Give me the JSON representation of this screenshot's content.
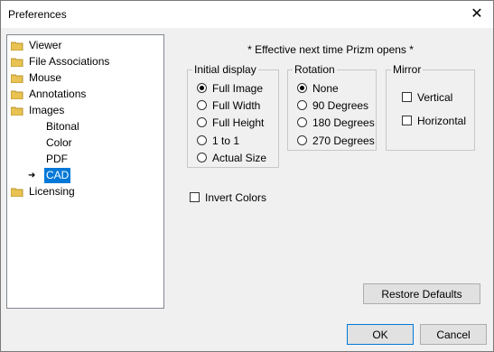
{
  "window": {
    "title": "Preferences",
    "close_glyph": "✕"
  },
  "tree": {
    "items": [
      {
        "label": "Viewer",
        "icon": "folder-icon"
      },
      {
        "label": "File Associations",
        "icon": "folder-icon"
      },
      {
        "label": "Mouse",
        "icon": "folder-icon"
      },
      {
        "label": "Annotations",
        "icon": "folder-icon"
      },
      {
        "label": "Images",
        "icon": "folder-icon"
      },
      {
        "label": "Bitonal"
      },
      {
        "label": "Color"
      },
      {
        "label": "PDF"
      },
      {
        "label": "CAD",
        "selected": true
      },
      {
        "label": "Licensing",
        "icon": "folder-icon"
      }
    ]
  },
  "note": "* Effective next time Prizm opens *",
  "initial_display": {
    "title": "Initial display",
    "options": [
      "Full Image",
      "Full Width",
      "Full Height",
      "1 to 1",
      "Actual Size"
    ],
    "selected": "Full Image"
  },
  "rotation": {
    "title": "Rotation",
    "options": [
      "None",
      "90 Degrees",
      "180 Degrees",
      "270 Degrees"
    ],
    "selected": "None"
  },
  "mirror": {
    "title": "Mirror",
    "options": [
      "Vertical",
      "Horizontal"
    ]
  },
  "invert_colors": {
    "label": "Invert Colors"
  },
  "buttons": {
    "restore_defaults": "Restore Defaults",
    "ok": "OK",
    "cancel": "Cancel"
  },
  "colors": {
    "selection": "#0078d7",
    "folder": "#e8c252"
  }
}
